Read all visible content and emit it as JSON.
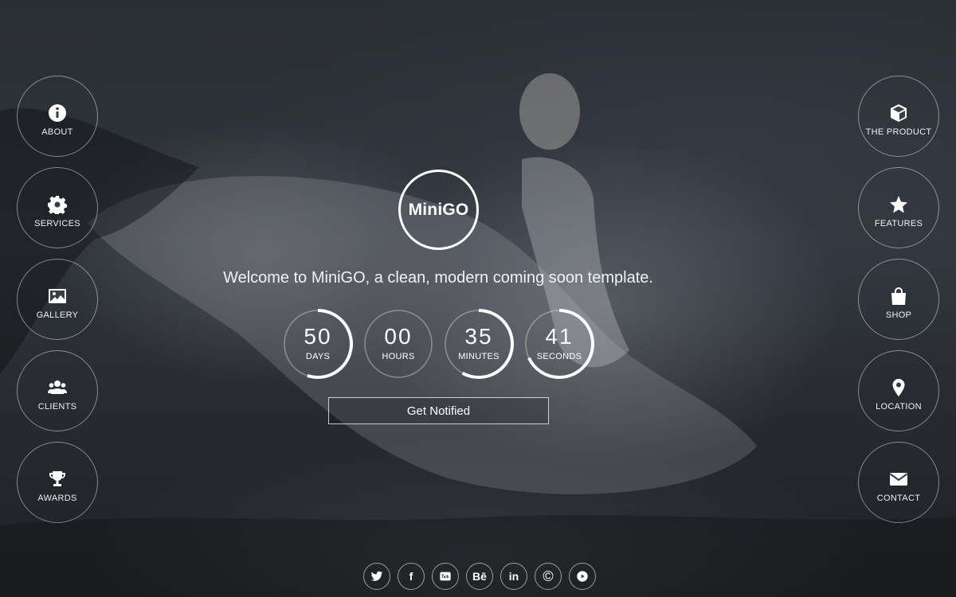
{
  "brand": {
    "logo_text": "MiniGO"
  },
  "tagline": "Welcome to MiniGO, a clean, modern coming soon template.",
  "left_nav": [
    {
      "label": "ABOUT",
      "icon": "info-icon"
    },
    {
      "label": "SERVICES",
      "icon": "gear-icon"
    },
    {
      "label": "GALLERY",
      "icon": "image-icon"
    },
    {
      "label": "CLIENTS",
      "icon": "users-icon"
    },
    {
      "label": "AWARDS",
      "icon": "trophy-icon"
    }
  ],
  "right_nav": [
    {
      "label": "THE PRODUCT",
      "icon": "cube-icon"
    },
    {
      "label": "FEATURES",
      "icon": "star-icon"
    },
    {
      "label": "SHOP",
      "icon": "shopping-bag-icon"
    },
    {
      "label": "LOCATION",
      "icon": "map-pin-icon"
    },
    {
      "label": "CONTACT",
      "icon": "envelope-icon"
    }
  ],
  "countdown": [
    {
      "value": "50",
      "label": "DAYS",
      "progress": 0.55
    },
    {
      "value": "00",
      "label": "HOURS",
      "progress": 0.0
    },
    {
      "value": "35",
      "label": "MINUTES",
      "progress": 0.58
    },
    {
      "value": "41",
      "label": "SECONDS",
      "progress": 0.68
    }
  ],
  "cta": {
    "label": "Get Notified"
  },
  "social": [
    {
      "icon": "twitter-icon",
      "glyph": ""
    },
    {
      "icon": "facebook-icon",
      "glyph": "f"
    },
    {
      "icon": "youtube-icon",
      "glyph": ""
    },
    {
      "icon": "behance-icon",
      "glyph": "Bē"
    },
    {
      "icon": "linkedin-icon",
      "glyph": "in"
    },
    {
      "icon": "copyright-icon",
      "glyph": "©"
    },
    {
      "icon": "play-icon",
      "glyph": ""
    }
  ]
}
